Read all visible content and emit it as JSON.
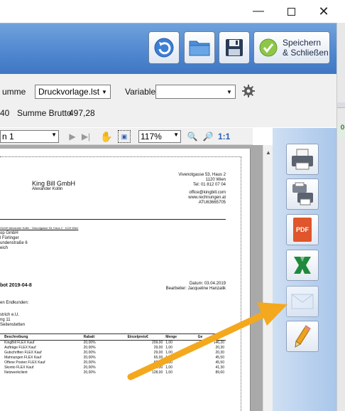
{
  "toolbar": {
    "refresh_icon": "refresh-icon",
    "open_icon": "folder-icon",
    "save_icon": "floppy-disk-icon",
    "save_close_label": "Speichern\n& Schließen"
  },
  "options": {
    "summe_label": "umme",
    "template_value": "Druckvorlage.lst",
    "variable_label": "Variable",
    "variable_value": "",
    "net_fragment": "40",
    "brutto_label": "Summe Brutto",
    "brutto_value": "497,28"
  },
  "preview_toolbar": {
    "page_value": "n 1",
    "zoom_value": "117%",
    "ratio_label": "1:1"
  },
  "document": {
    "company_name": "King Bill GmbH",
    "company_person": "Alexander Kollin",
    "address_line1": "Vivenotgasse 53, Haus 2",
    "address_line2": "1120 Wien",
    "address_line3": "Tel: 01 812 07 04",
    "address_line4": "office@kingbill.com",
    "address_line5": "www.rechnungen.at",
    "address_line6": "ATU63665705",
    "sender_line": "GmbH Alexander Kollin · Viwnotgasse 53, Haus 2 · 1120 Wien",
    "recipient_line1": "op GmbH",
    "recipient_line2": "l Fürlinger",
    "recipient_line3": "undenstraße 6",
    "recipient_line4": "eich",
    "offer_title": "bot 2019-04-8",
    "date_label": "Datum: 03.04.2019",
    "editor_label": "Bearbeiter: Jacqueline Hanzalik",
    "greeting": "en Endkunden:",
    "contact_line1": "strich e.U.",
    "contact_line2": "ng 11",
    "contact_line3": "Seitenstetten",
    "table_headers": [
      "Beschreibung",
      "Rabatt",
      "Einzelpreis€",
      "Menge",
      "Ge"
    ],
    "table_rows": [
      [
        "KingBill FLEX Kauf",
        "20,00%",
        "209,00",
        "1,00",
        "146,20"
      ],
      [
        "Aufträge FLEX Kauf",
        "20,00%",
        "29,00",
        "1,00",
        "20,30"
      ],
      [
        "Gutschriften FLEX Kauf",
        "20,00%",
        "29,00",
        "1,00",
        "20,30"
      ],
      [
        "Mahnungen FLEX Kauf",
        "20,00%",
        "65,00",
        "1,00",
        "45,50"
      ],
      [
        "Offene Posten FLEX Kauf",
        "20,00%",
        "65,00",
        "1,00",
        "45,50"
      ],
      [
        "Skonto FLEX Kauf",
        "20,00%",
        "59,00",
        "1,00",
        "41,30"
      ],
      [
        "Netzwerkclient",
        "20,00%",
        "128,00",
        "1,00",
        "89,60"
      ]
    ]
  },
  "sidebar": {
    "print_icon": "printer-icon",
    "print_setup_icon": "multi-printer-icon",
    "pdf_label": "PDF",
    "excel_icon": "excel-icon",
    "email_icon": "envelope-icon",
    "edit_icon": "pencil-icon"
  },
  "colors": {
    "toolbar_blue": "#4f86cf",
    "arrow_orange": "#f4a81d",
    "pdf_red": "#e0552b",
    "excel_green": "#1f8a3b"
  }
}
